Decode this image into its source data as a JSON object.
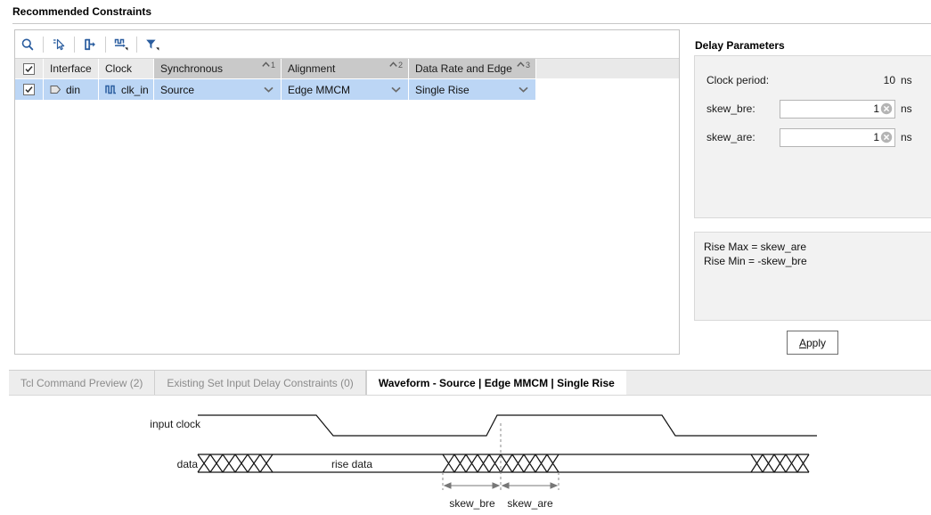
{
  "panels": {
    "recommended_constraints_title": "Recommended Constraints",
    "delay_parameters_title": "Delay Parameters"
  },
  "toolbar": {
    "buttons": [
      {
        "name": "search-icon",
        "tooltip": "Search"
      },
      {
        "name": "select-pointer-icon",
        "tooltip": "Select"
      },
      {
        "name": "auto-arrange-icon",
        "tooltip": "Auto Arrange"
      },
      {
        "name": "waveform-icon",
        "tooltip": "Waveform"
      },
      {
        "name": "filter-icon",
        "tooltip": "Filter"
      }
    ]
  },
  "table": {
    "columns": [
      {
        "label": "",
        "sort": "",
        "sorted": false
      },
      {
        "label": "Interface",
        "sort": "",
        "sorted": false
      },
      {
        "label": "Clock",
        "sort": "",
        "sorted": false
      },
      {
        "label": "Synchronous",
        "sort": "1",
        "sorted": true
      },
      {
        "label": "Alignment",
        "sort": "2",
        "sorted": true
      },
      {
        "label": "Data Rate and Edge",
        "sort": "3",
        "sorted": true
      }
    ],
    "header_checked": true,
    "rows": [
      {
        "checked": true,
        "interface": "din",
        "interface_icon": "port-icon",
        "clock": "clk_in",
        "clock_icon": "clock-signal-icon",
        "synchronous": "Source",
        "alignment": "Edge MMCM",
        "data_rate_and_edge": "Single Rise"
      }
    ]
  },
  "delay_parameters": {
    "clock_period": {
      "label": "Clock period:",
      "value": "10",
      "unit": "ns"
    },
    "skew_bre": {
      "label": "skew_bre:",
      "value": "1",
      "unit": "ns"
    },
    "skew_are": {
      "label": "skew_are:",
      "value": "1",
      "unit": "ns"
    }
  },
  "formula": {
    "lines": [
      "Rise Max = skew_are",
      "Rise Min = -skew_bre"
    ]
  },
  "apply_button": {
    "mnemonic": "A",
    "rest": "pply"
  },
  "tabs": [
    {
      "label": "Tcl Command Preview (2)",
      "active": false
    },
    {
      "label": "Existing Set Input Delay Constraints (0)",
      "active": false
    },
    {
      "label": "Waveform - Source | Edge MMCM | Single Rise",
      "active": true
    }
  ],
  "waveform": {
    "row_labels": {
      "clock": "input clock",
      "data": "data"
    },
    "data_label": "rise data",
    "measurements": [
      {
        "label": "skew_bre"
      },
      {
        "label": "skew_are"
      }
    ]
  },
  "colors": {
    "selection": "#bcd6f5",
    "header": "#e9e9e9",
    "header_sorted": "#c9c9c9",
    "panel_bg": "#f2f2f2",
    "icon_blue": "#2a5d9f"
  }
}
